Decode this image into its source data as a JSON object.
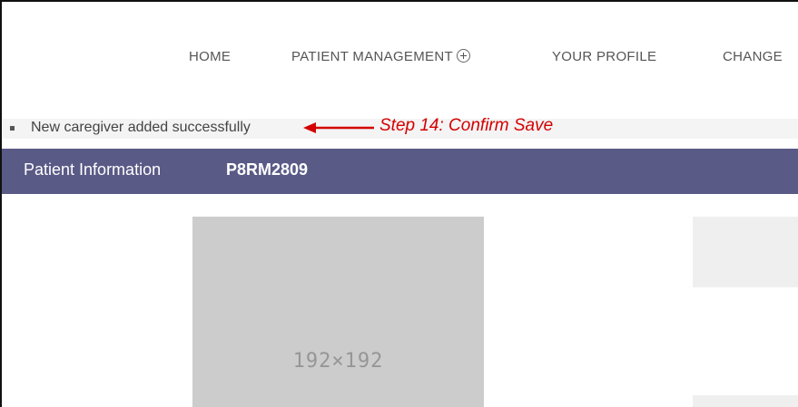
{
  "nav": {
    "home": "HOME",
    "patient_management": "PATIENT MANAGEMENT",
    "your_profile": "YOUR PROFILE",
    "change": "CHANGE"
  },
  "message": {
    "text": "New caregiver added successfully"
  },
  "annotation": {
    "text": "Step 14: Confirm Save",
    "color": "#d40000"
  },
  "header": {
    "title": "Patient Information",
    "patient_id": "P8RM2809",
    "background": "#5a5a87"
  },
  "photo": {
    "placeholder_text": "192×192"
  }
}
